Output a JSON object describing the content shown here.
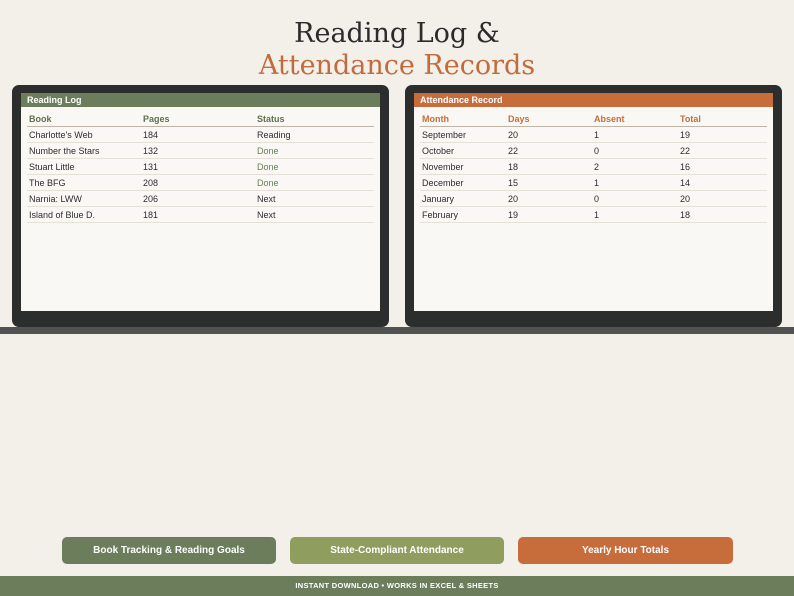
{
  "header": {
    "title_line1": "Reading Log &",
    "title_line2": "Attendance Records"
  },
  "reading_log": {
    "title": "Reading Log",
    "columns": [
      "Book",
      "Pages",
      "Status"
    ],
    "rows": [
      [
        "Charlotte's Web",
        "184",
        "Reading"
      ],
      [
        "Number the Stars",
        "132",
        "Done"
      ],
      [
        "Stuart Little",
        "131",
        "Done"
      ],
      [
        "The BFG",
        "208",
        "Done"
      ],
      [
        "Narnia: LWW",
        "206",
        "Next"
      ],
      [
        "Island of Blue D.",
        "181",
        "Next"
      ]
    ]
  },
  "attendance": {
    "title": "Attendance Record",
    "columns": [
      "Month",
      "Days",
      "Absent",
      "Total"
    ],
    "rows": [
      [
        "September",
        "20",
        "1",
        "19"
      ],
      [
        "October",
        "22",
        "0",
        "22"
      ],
      [
        "November",
        "18",
        "2",
        "16"
      ],
      [
        "December",
        "15",
        "1",
        "14"
      ],
      [
        "January",
        "20",
        "0",
        "20"
      ],
      [
        "February",
        "19",
        "1",
        "18"
      ]
    ]
  },
  "features": {
    "book_tracking": "Book Tracking & Reading Goals",
    "attendance": "State-Compliant Attendance",
    "hour_totals": "Yearly Hour Totals"
  },
  "footer": {
    "text": "INSTANT DOWNLOAD  •  WORKS IN EXCEL & SHEETS"
  },
  "colors": {
    "sage": "#6b7d5a",
    "olive": "#8f9e5e",
    "terracotta": "#c76d3c",
    "background": "#f3efe9"
  }
}
